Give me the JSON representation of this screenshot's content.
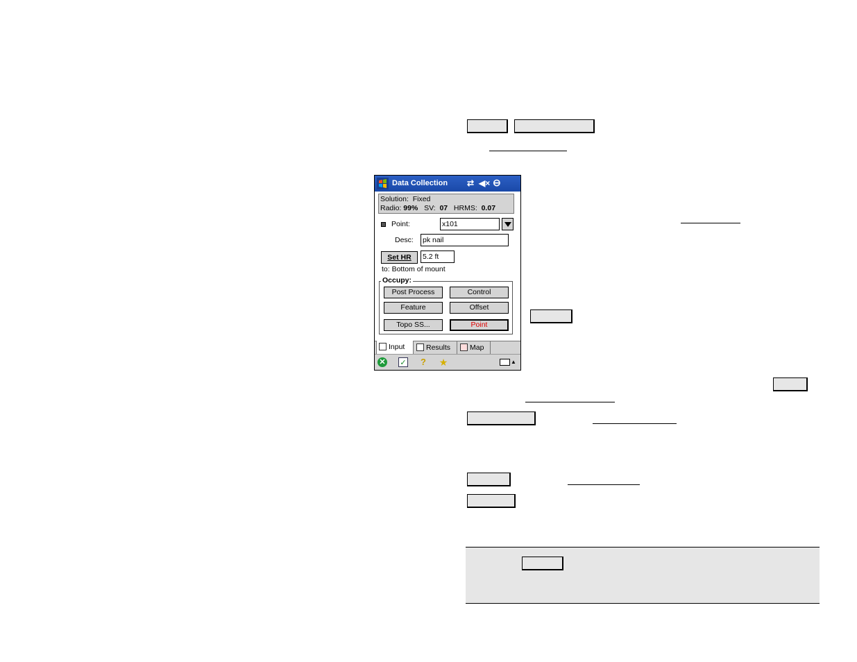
{
  "device": {
    "title": "Data Collection",
    "titlebar_icons": {
      "sync": "⇄",
      "volume": "◀×",
      "power": "⊖"
    },
    "status": {
      "solution_label": "Solution:",
      "solution_value": "Fixed",
      "radio_label": "Radio:",
      "radio_value": "99%",
      "sv_label": "SV:",
      "sv_value": "07",
      "hrms_label": "HRMS:",
      "hrms_value": "0.07"
    },
    "point_label": "Point:",
    "point_value": "x101",
    "desc_label": "Desc:",
    "desc_value": "pk nail",
    "set_hr_label": "Set HR",
    "hr_value": "5.2 ft",
    "hr_to_text": "to: Bottom of mount",
    "occupy_label": "Occupy:",
    "buttons": {
      "post_process": "Post Process",
      "control": "Control",
      "feature": "Feature",
      "offset": "Offset",
      "topo_ss": "Topo SS...",
      "point": "Point"
    },
    "tabs": {
      "input": "Input",
      "results": "Results",
      "map": "Map"
    }
  },
  "colors": {
    "titlebar": "#2c5fc4",
    "panel": "#d4d4d4",
    "point_button_text": "#e00000",
    "note_background": "#e6e6e6"
  }
}
